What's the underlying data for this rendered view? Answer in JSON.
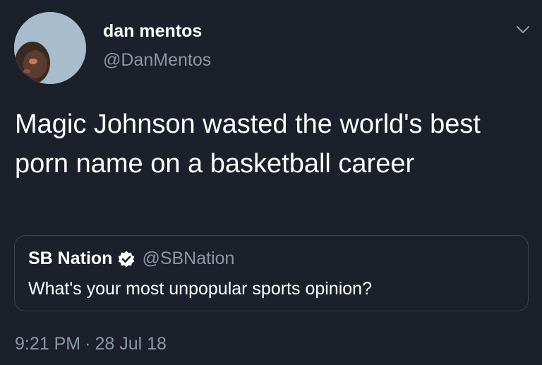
{
  "author": {
    "name": "dan mentos",
    "handle": "@DanMentos",
    "avatar_icon": "profile-photo"
  },
  "tweet": {
    "text": "Magic Johnson wasted the world's best porn name on a basketball career",
    "time": "9:21 PM",
    "separator": "·",
    "date": "28 Jul 18"
  },
  "quoted_tweet": {
    "name": "SB Nation",
    "verified_icon": "verified-badge-icon",
    "handle": "@SBNation",
    "text": "What's your most unpopular sports opinion?"
  },
  "menu_icon": "chevron-down-icon",
  "colors": {
    "background": "#1b202a",
    "text_primary": "#ffffff",
    "text_secondary": "#8b98a5",
    "border": "#3a4452"
  }
}
